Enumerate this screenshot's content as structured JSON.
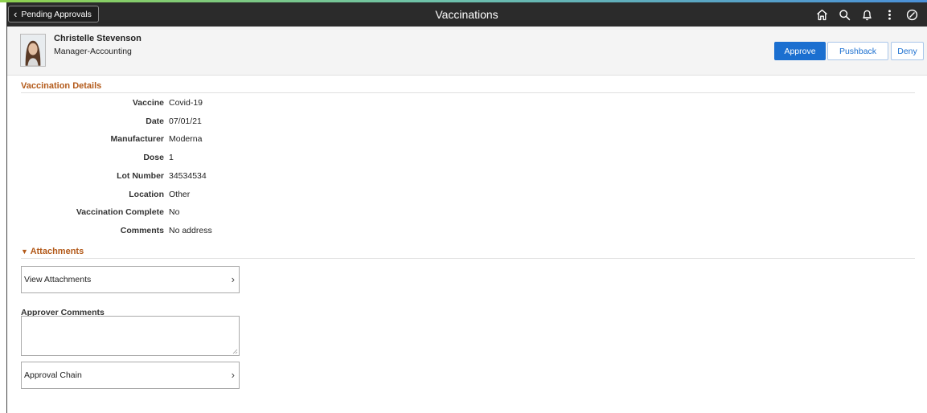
{
  "header": {
    "back_label": "Pending Approvals",
    "title": "Vaccinations",
    "icons": [
      "home-icon",
      "search-icon",
      "notification-icon",
      "more-options-icon",
      "nav-compass-icon"
    ],
    "colors": {
      "bar": "#2b2b2b",
      "accent": "#b35a1a",
      "primary": "#1b6fd0"
    }
  },
  "user": {
    "name": "Christelle Stevenson",
    "title": "Manager-Accounting"
  },
  "actions": {
    "approve": "Approve",
    "pushback": "Pushback",
    "deny": "Deny"
  },
  "details": {
    "section_title": "Vaccination Details",
    "fields": [
      {
        "label": "Vaccine",
        "value": "Covid-19"
      },
      {
        "label": "Date",
        "value": "07/01/21"
      },
      {
        "label": "Manufacturer",
        "value": "Moderna"
      },
      {
        "label": "Dose",
        "value": "1"
      },
      {
        "label": "Lot Number",
        "value": "34534534"
      },
      {
        "label": "Location",
        "value": "Other"
      },
      {
        "label": "Vaccination Complete",
        "value": "No"
      },
      {
        "label": "Comments",
        "value": "No address"
      }
    ]
  },
  "attachments": {
    "section_title": "Attachments",
    "view_label": "View Attachments"
  },
  "approver_comments": {
    "label": "Approver Comments",
    "value": ""
  },
  "approval_chain": {
    "label": "Approval Chain"
  }
}
